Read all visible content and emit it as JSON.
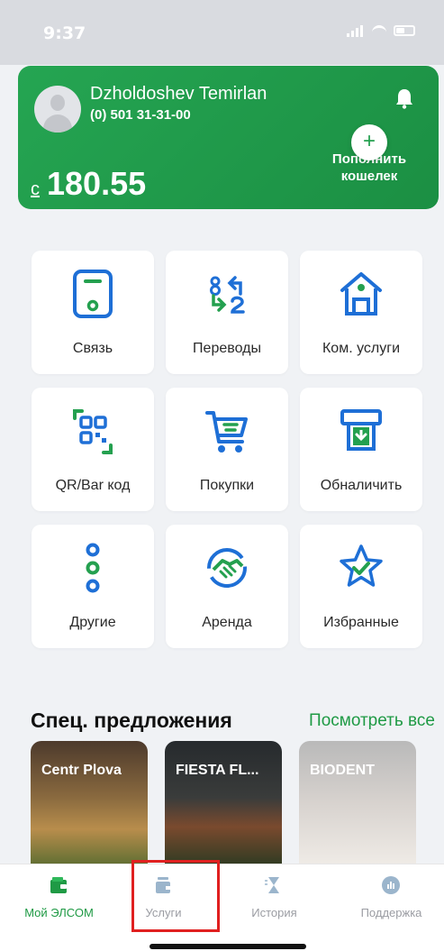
{
  "status": {
    "time": "9:37"
  },
  "wallet": {
    "user_name": "Dzholdoshev Temirlan",
    "phone": "(0) 501 31-31-00",
    "currency": "с",
    "balance": "180.55",
    "topup_label": "Пополнить кошелек",
    "topup_icon": "+"
  },
  "services": [
    {
      "label": "Связь",
      "icon": "phone-icon"
    },
    {
      "label": "Переводы",
      "icon": "transfer-icon"
    },
    {
      "label": "Ком. услуги",
      "icon": "house-icon"
    },
    {
      "label": "QR/Bar код",
      "icon": "qr-icon"
    },
    {
      "label": "Покупки",
      "icon": "cart-icon"
    },
    {
      "label": "Обналичить",
      "icon": "cash-out-icon"
    },
    {
      "label": "Другие",
      "icon": "more-dots-icon"
    },
    {
      "label": "Аренда",
      "icon": "handshake-icon"
    },
    {
      "label": "Избранные",
      "icon": "star-icon"
    }
  ],
  "offers": {
    "title": "Спец. предложения",
    "see_all": "Посмотреть все",
    "items": [
      {
        "name": "Centr Plova"
      },
      {
        "name": "FIESTA FL..."
      },
      {
        "name": "BIODENT"
      }
    ]
  },
  "tabs": [
    {
      "label": "Мой ЭЛСОМ",
      "icon": "wallet-icon",
      "active": true
    },
    {
      "label": "Услуги",
      "icon": "services-icon",
      "active": false
    },
    {
      "label": "История",
      "icon": "hourglass-icon",
      "active": false
    },
    {
      "label": "Поддержка",
      "icon": "support-icon",
      "active": false
    }
  ],
  "colors": {
    "brand_green": "#24a04f",
    "icon_blue": "#1e6fd6",
    "highlight_red": "#e02020"
  }
}
